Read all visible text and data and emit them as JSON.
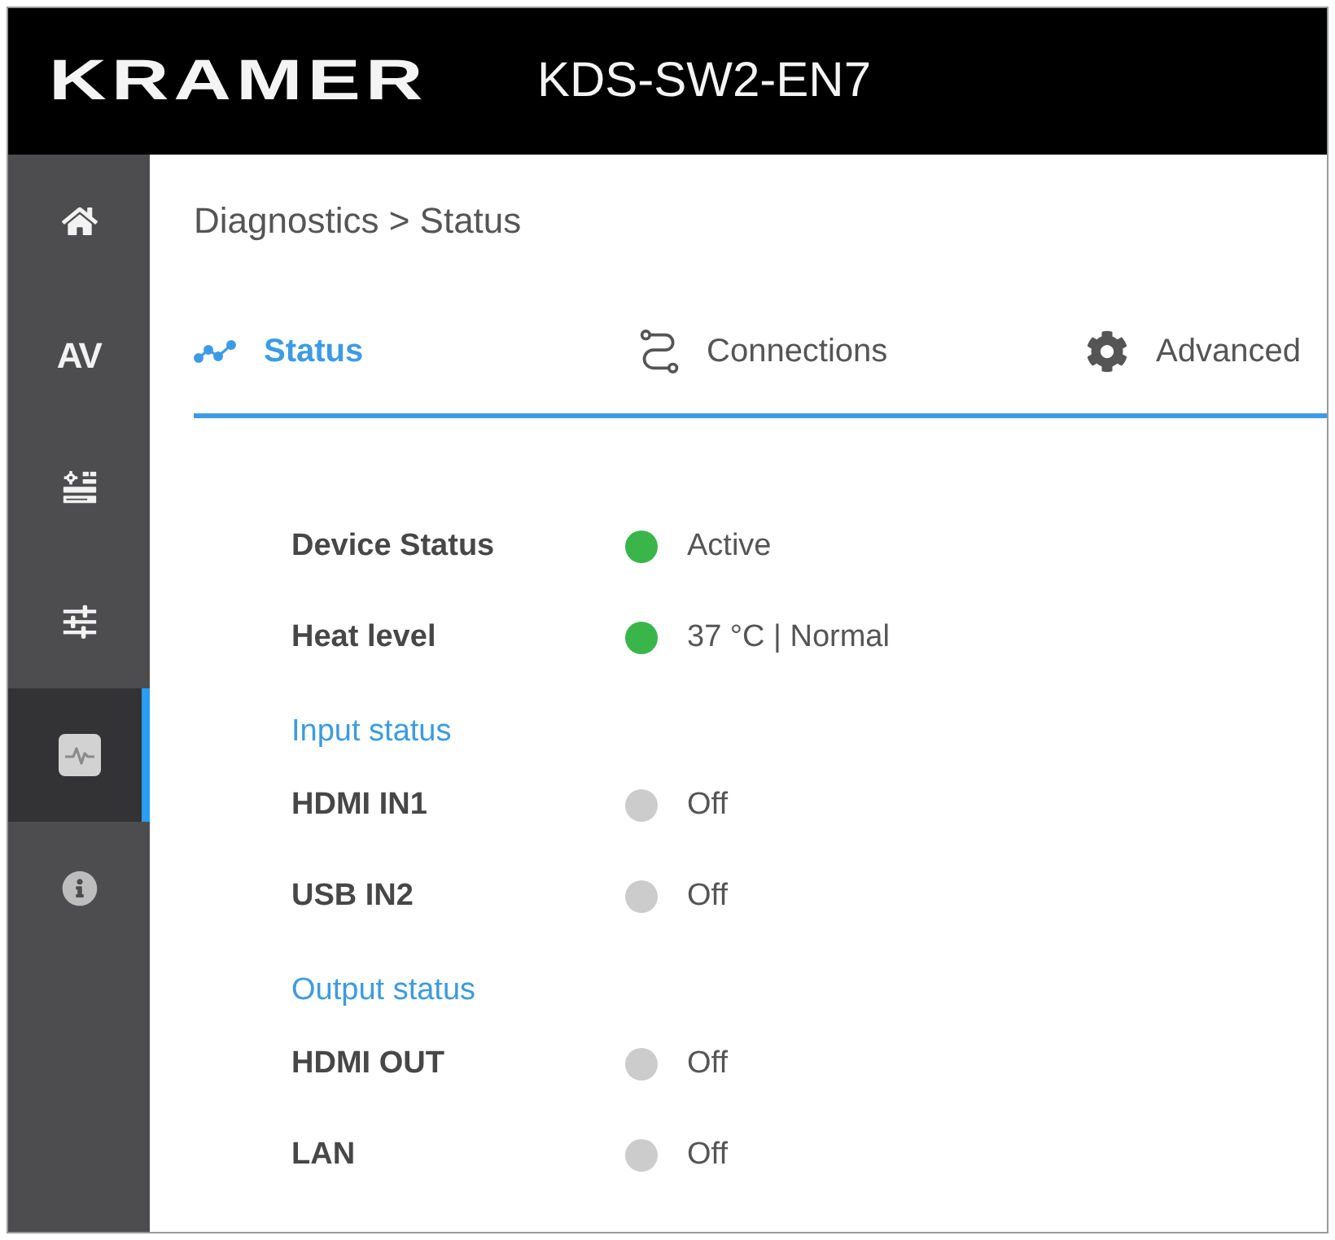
{
  "header": {
    "logo": "KRAMER",
    "model": "KDS-SW2-EN7"
  },
  "sidebar": {
    "items": [
      {
        "kind": "home",
        "selected": false
      },
      {
        "kind": "text",
        "label": "AV",
        "selected": false
      },
      {
        "kind": "settings",
        "selected": false
      },
      {
        "kind": "sliders",
        "selected": false
      },
      {
        "kind": "diagnostics",
        "selected": true
      },
      {
        "kind": "info",
        "selected": false
      }
    ]
  },
  "breadcrumb": "Diagnostics > Status",
  "tabs": [
    {
      "kind": "pulse",
      "label": "Status",
      "selected": true
    },
    {
      "kind": "connections",
      "label": "Connections",
      "selected": false
    },
    {
      "kind": "gear",
      "label": "Advanced",
      "selected": false
    }
  ],
  "status": [
    {
      "kind": "row",
      "label": "Device Status",
      "value": "Active",
      "color": "#3ab54a"
    },
    {
      "kind": "row",
      "label": "Heat level",
      "value": "37 °C | Normal",
      "color": "#3ab54a"
    },
    {
      "kind": "heading",
      "label": "Input status"
    },
    {
      "kind": "row",
      "label": "HDMI IN1",
      "value": "Off",
      "color": "#cccccc"
    },
    {
      "kind": "row",
      "label": "USB IN2",
      "value": "Off",
      "color": "#cccccc"
    },
    {
      "kind": "heading",
      "label": "Output status"
    },
    {
      "kind": "row",
      "label": "HDMI OUT",
      "value": "Off",
      "color": "#cccccc"
    },
    {
      "kind": "row",
      "label": "LAN",
      "value": "Off",
      "color": "#cccccc"
    }
  ]
}
